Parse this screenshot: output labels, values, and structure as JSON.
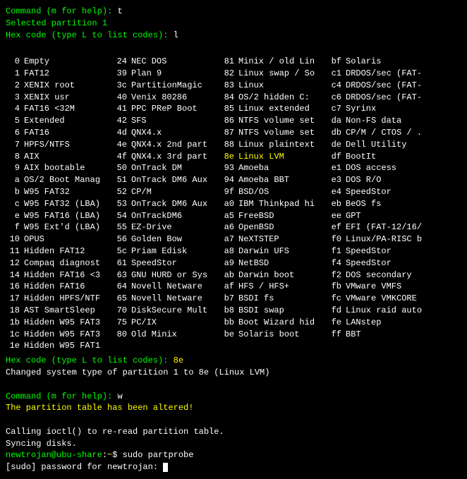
{
  "prompt_command": "Command (m for help): ",
  "input_t": "t",
  "selected_msg": "Selected partition 1",
  "prompt_hex": "Hex code (type L to list codes): ",
  "input_l": "l",
  "hex_table": [
    [
      "0",
      "Empty",
      "24",
      "NEC DOS",
      "81",
      "Minix / old Lin",
      "bf",
      "Solaris"
    ],
    [
      "1",
      "FAT12",
      "39",
      "Plan 9",
      "82",
      "Linux swap / So",
      "c1",
      "DRDOS/sec (FAT-"
    ],
    [
      "2",
      "XENIX root",
      "3c",
      "PartitionMagic",
      "83",
      "Linux",
      "c4",
      "DRDOS/sec (FAT-"
    ],
    [
      "3",
      "XENIX usr",
      "40",
      "Venix 80286",
      "84",
      "OS/2 hidden C:",
      "c6",
      "DRDOS/sec (FAT-"
    ],
    [
      "4",
      "FAT16 <32M",
      "41",
      "PPC PReP Boot",
      "85",
      "Linux extended",
      "c7",
      "Syrinx"
    ],
    [
      "5",
      "Extended",
      "42",
      "SFS",
      "86",
      "NTFS volume set",
      "da",
      "Non-FS data"
    ],
    [
      "6",
      "FAT16",
      "4d",
      "QNX4.x",
      "87",
      "NTFS volume set",
      "db",
      "CP/M / CTOS / ."
    ],
    [
      "7",
      "HPFS/NTFS",
      "4e",
      "QNX4.x 2nd part",
      "88",
      "Linux plaintext",
      "de",
      "Dell Utility"
    ],
    [
      "8",
      "AIX",
      "4f",
      "QNX4.x 3rd part",
      "8e",
      "Linux LVM",
      "df",
      "BootIt"
    ],
    [
      "9",
      "AIX bootable",
      "50",
      "OnTrack DM",
      "93",
      "Amoeba",
      "e1",
      "DOS access"
    ],
    [
      "a",
      "OS/2 Boot Manag",
      "51",
      "OnTrack DM6 Aux",
      "94",
      "Amoeba BBT",
      "e3",
      "DOS R/O"
    ],
    [
      "b",
      "W95 FAT32",
      "52",
      "CP/M",
      "9f",
      "BSD/OS",
      "e4",
      "SpeedStor"
    ],
    [
      "c",
      "W95 FAT32 (LBA)",
      "53",
      "OnTrack DM6 Aux",
      "a0",
      "IBM Thinkpad hi",
      "eb",
      "BeOS fs"
    ],
    [
      "e",
      "W95 FAT16 (LBA)",
      "54",
      "OnTrackDM6",
      "a5",
      "FreeBSD",
      "ee",
      "GPT"
    ],
    [
      "f",
      "W95 Ext'd (LBA)",
      "55",
      "EZ-Drive",
      "a6",
      "OpenBSD",
      "ef",
      "EFI (FAT-12/16/"
    ],
    [
      "10",
      "OPUS",
      "56",
      "Golden Bow",
      "a7",
      "NeXTSTEP",
      "f0",
      "Linux/PA-RISC b"
    ],
    [
      "11",
      "Hidden FAT12",
      "5c",
      "Priam Edisk",
      "a8",
      "Darwin UFS",
      "f1",
      "SpeedStor"
    ],
    [
      "12",
      "Compaq diagnost",
      "61",
      "SpeedStor",
      "a9",
      "NetBSD",
      "f4",
      "SpeedStor"
    ],
    [
      "14",
      "Hidden FAT16 <3",
      "63",
      "GNU HURD or Sys",
      "ab",
      "Darwin boot",
      "f2",
      "DOS secondary"
    ],
    [
      "16",
      "Hidden FAT16",
      "64",
      "Novell Netware",
      "af",
      "HFS / HFS+",
      "fb",
      "VMware VMFS"
    ],
    [
      "17",
      "Hidden HPFS/NTF",
      "65",
      "Novell Netware",
      "b7",
      "BSDI fs",
      "fc",
      "VMware VMKCORE"
    ],
    [
      "18",
      "AST SmartSleep",
      "70",
      "DiskSecure Mult",
      "b8",
      "BSDI swap",
      "fd",
      "Linux raid auto"
    ],
    [
      "1b",
      "Hidden W95 FAT3",
      "75",
      "PC/IX",
      "bb",
      "Boot Wizard hid",
      "fe",
      "LANstep"
    ],
    [
      "1c",
      "Hidden W95 FAT3",
      "80",
      "Old Minix",
      "be",
      "Solaris boot",
      "ff",
      "BBT"
    ],
    [
      "1e",
      "Hidden W95 FAT1",
      "",
      "",
      "",
      "",
      "",
      ""
    ]
  ],
  "highlight_code": "8e",
  "highlight_name": "Linux LVM",
  "input_8e": "8e",
  "changed_msg": "Changed system type of partition 1 to 8e (Linux LVM)",
  "input_w": "w",
  "altered_msg": "The partition table has been altered!",
  "ioctl_msg": "Calling ioctl() to re-read partition table.",
  "sync_msg": "Syncing disks.",
  "shell_user": "newtrojan@ubu-share",
  "shell_sep": ":",
  "shell_path": "~",
  "shell_dollar": "$ ",
  "shell_cmd": "sudo partprobe",
  "sudo_prompt": "[sudo] password for newtrojan:"
}
